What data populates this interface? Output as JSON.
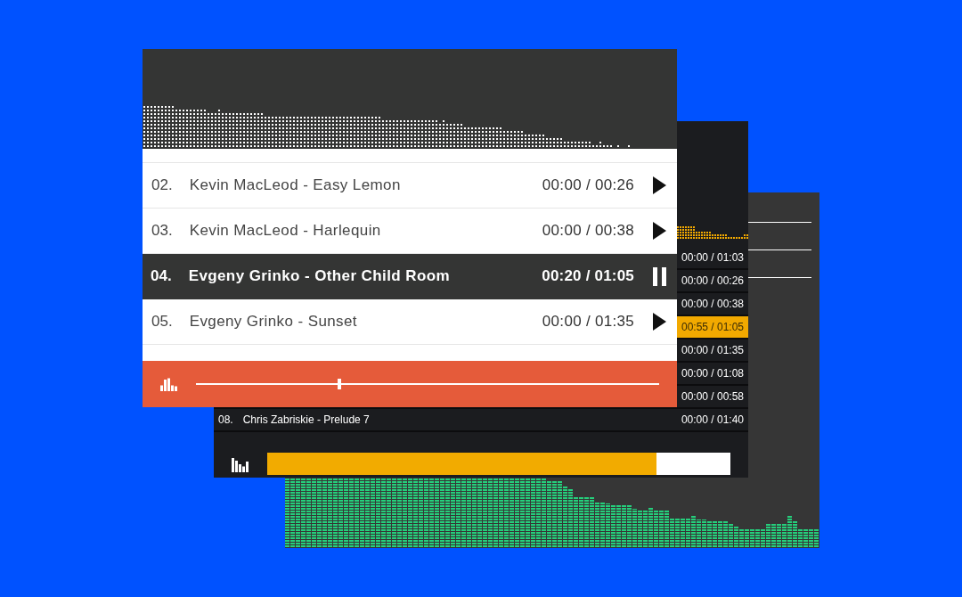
{
  "front_player": {
    "tracks": [
      {
        "number": "02.",
        "title": "Kevin MacLeod - Easy Lemon",
        "time": "00:00 / 00:26",
        "selected": false
      },
      {
        "number": "03.",
        "title": "Kevin MacLeod - Harlequin",
        "time": "00:00 / 00:38",
        "selected": false
      },
      {
        "number": "04.",
        "title": "Evgeny Grinko - Other Child Room",
        "time": "00:20 / 01:05",
        "selected": true
      },
      {
        "number": "05.",
        "title": "Evgeny Grinko - Sunset",
        "time": "00:00 / 01:35",
        "selected": false
      }
    ],
    "seek": {
      "level": 0.31
    }
  },
  "middle_player": {
    "tracks": [
      {
        "time": "00:00 / 01:03",
        "selected": false
      },
      {
        "time": "00:00 / 00:26",
        "selected": false
      },
      {
        "time": "00:00 / 00:38",
        "selected": false
      },
      {
        "time": "00:55 / 01:05",
        "selected": true
      },
      {
        "time": "00:00 / 01:35",
        "selected": false
      },
      {
        "time": "00:00 / 01:08",
        "selected": false
      },
      {
        "time": "00:00 / 00:58",
        "selected": false
      },
      {
        "number": "08.",
        "title": "Chris Zabriskie - Prelude 7",
        "time": "00:00 / 01:40",
        "selected": false
      }
    ],
    "progress": {
      "level": 0.84
    }
  }
}
